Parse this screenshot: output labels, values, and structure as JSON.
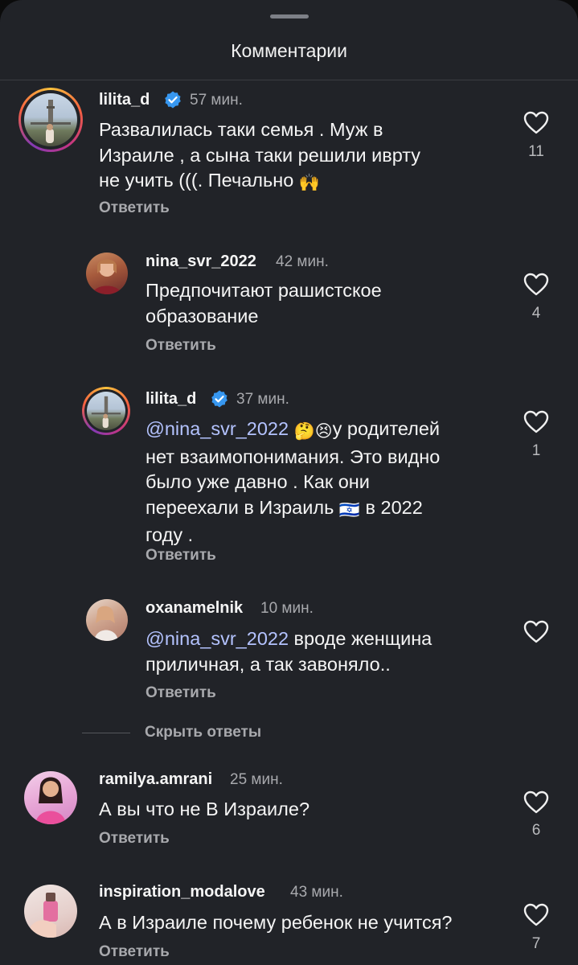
{
  "sheet": {
    "title": "Комментарии"
  },
  "actions": {
    "reply_label": "Ответить",
    "hide_replies": "Скрыть ответы"
  },
  "comments": [
    {
      "username": "lilita_d",
      "verified": true,
      "time": "57 мин.",
      "text": "Развалилась таки семья . Муж в Израиле , а сына таки решили иврту не учить (((. Печально 🙌",
      "lines": [
        "Развалилась таки семья . Муж в",
        "Израиле , а сына таки решили иврту",
        "не учить (((. Печально"
      ],
      "emoji": "🙌",
      "likes": "11"
    },
    {
      "username": "nina_svr_2022",
      "verified": false,
      "time": "42 мин.",
      "lines": [
        "Предпочитают рашистское",
        "образование"
      ],
      "likes": "4"
    },
    {
      "username": "lilita_d",
      "verified": true,
      "time": "37 мин.",
      "mention": "@nina_svr_2022",
      "emoji": "🤔😣",
      "lines": [
        "у родителей",
        "нет взаимопонимания. Это видно",
        "было уже давно . Как  они",
        "переехали  в Израиль",
        "в 2022",
        "году ."
      ],
      "flag": "🇮🇱",
      "likes": "1"
    },
    {
      "username": "oxanamelnik",
      "verified": false,
      "time": "10 мин.",
      "mention": "@nina_svr_2022",
      "lines": [
        " вроде женщина",
        "приличная, а так завоняло.."
      ],
      "likes": ""
    },
    {
      "username": "ramilya.amrani",
      "verified": false,
      "time": "25 мин.",
      "lines": [
        "А вы что не В Израиле?"
      ],
      "likes": "6"
    },
    {
      "username": "inspiration_modalove",
      "verified": false,
      "time": "43 мин.",
      "lines": [
        "А в Израиле почему ребенок не учится?"
      ],
      "likes": "7"
    }
  ],
  "icons": {
    "like": "heart-outline-icon",
    "verified": "verified-badge-icon",
    "mention": "threads-at-icon"
  },
  "colors": {
    "background": "#212328",
    "mention": "#b4c3ff",
    "verified": "#3797f0",
    "secondary_text": "#a8a9ad"
  }
}
